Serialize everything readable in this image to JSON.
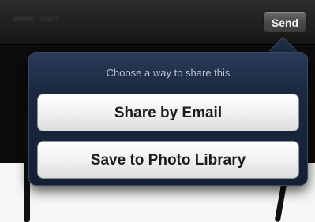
{
  "header": {
    "url_text": "www.                .com",
    "send_label": "Send"
  },
  "share_popover": {
    "title": "Choose a way to share this",
    "options": [
      {
        "label": "Share by Email"
      },
      {
        "label": "Save to Photo Library"
      }
    ]
  },
  "colors": {
    "popover_bg": "#1b2840",
    "topbar_bg": "#161616",
    "button_bg": "#f1f1f1"
  }
}
